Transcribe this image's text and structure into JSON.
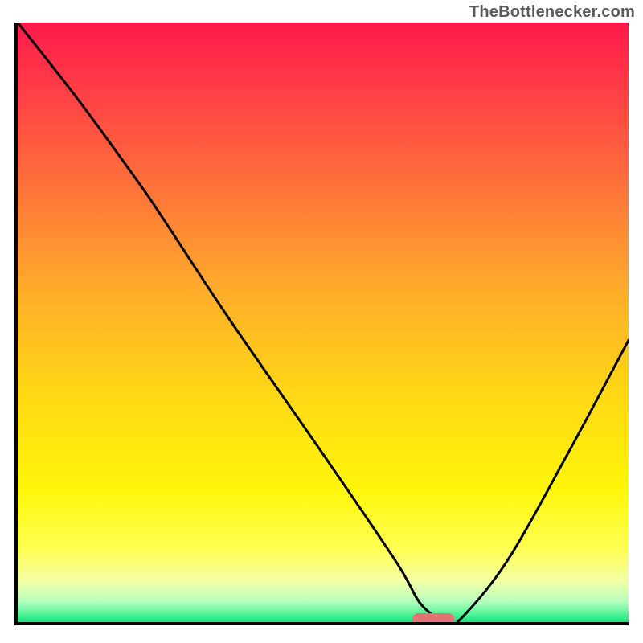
{
  "watermark": {
    "text": "TheBottlenecker.com"
  },
  "chart_data": {
    "type": "line",
    "title": "",
    "xlabel": "",
    "ylabel": "",
    "xlim": [
      0,
      100
    ],
    "ylim": [
      0,
      100
    ],
    "grid": false,
    "legend": false,
    "background_gradient_stops": [
      {
        "pos": 0.0,
        "color": "#ff1a4a"
      },
      {
        "pos": 0.1,
        "color": "#ff3a47"
      },
      {
        "pos": 0.25,
        "color": "#ff6a3c"
      },
      {
        "pos": 0.45,
        "color": "#ffad2a"
      },
      {
        "pos": 0.62,
        "color": "#ffd815"
      },
      {
        "pos": 0.78,
        "color": "#fff60a"
      },
      {
        "pos": 0.88,
        "color": "#ffff55"
      },
      {
        "pos": 0.93,
        "color": "#f4ffa3"
      },
      {
        "pos": 0.965,
        "color": "#b8ffbf"
      },
      {
        "pos": 0.985,
        "color": "#5af59b"
      },
      {
        "pos": 1.0,
        "color": "#19e27e"
      }
    ],
    "series": [
      {
        "name": "bottleneck-curve",
        "x": [
          0,
          10,
          20,
          24,
          35,
          50,
          62,
          66,
          70,
          72,
          80,
          90,
          100
        ],
        "y": [
          100,
          87,
          73,
          67,
          50,
          28,
          10,
          3,
          0,
          0,
          10,
          28,
          47
        ]
      }
    ],
    "marker": {
      "x": 68,
      "y": 0,
      "color": "#e77275"
    }
  }
}
